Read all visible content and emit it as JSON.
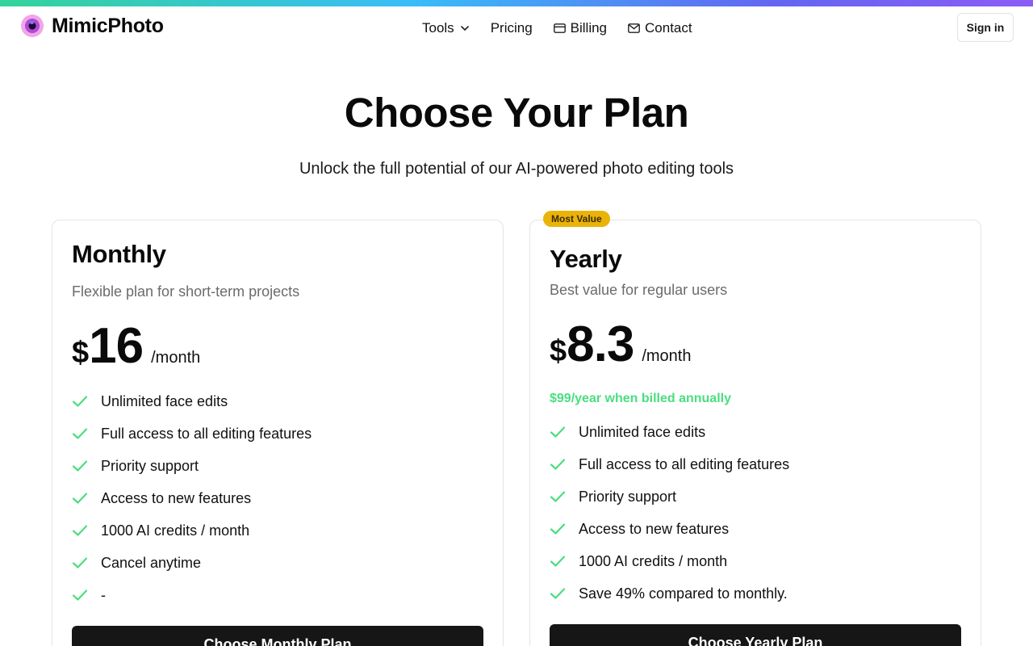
{
  "brand": {
    "name": "MimicPhoto"
  },
  "nav": {
    "tools": "Tools",
    "pricing": "Pricing",
    "billing": "Billing",
    "contact": "Contact"
  },
  "header": {
    "signin": "Sign in"
  },
  "hero": {
    "title": "Choose Your Plan",
    "subtitle": "Unlock the full potential of our AI-powered photo editing tools"
  },
  "plans": [
    {
      "name": "Monthly",
      "description": "Flexible plan for short-term projects",
      "currency": "$",
      "amount": "16",
      "period": "/month",
      "features": [
        "Unlimited face edits",
        "Full access to all editing features",
        "Priority support",
        "Access to new features",
        "1000 AI credits / month",
        "Cancel anytime",
        "-"
      ],
      "cta": "Choose Monthly Plan"
    },
    {
      "badge": "Most Value",
      "name": "Yearly",
      "description": "Best value for regular users",
      "currency": "$",
      "amount": "8.3",
      "period": "/month",
      "billed_note": "$99/year when billed annually",
      "features": [
        "Unlimited face edits",
        "Full access to all editing features",
        "Priority support",
        "Access to new features",
        "1000 AI credits / month",
        "Save 49% compared to monthly."
      ],
      "cta": "Choose Yearly Plan"
    }
  ],
  "colors": {
    "check": "#4ade80",
    "badge": "#eab308",
    "cta": "#161616"
  },
  "icons": {
    "check": "check-icon",
    "billing": "credit-card-icon",
    "contact": "mail-icon",
    "tools_chevron": "chevron-down-icon"
  }
}
